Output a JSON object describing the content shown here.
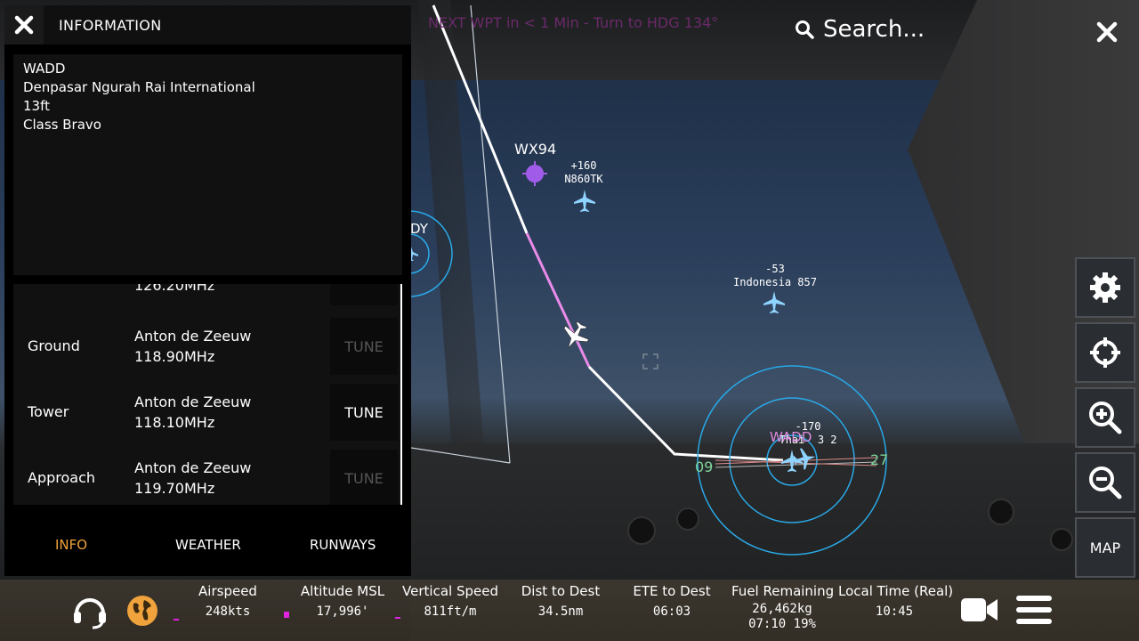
{
  "map": {
    "waypoint_message": "NEXT WPT in < 1 Min - Turn to HDG 134°",
    "weather_station": "WX94",
    "aircraft": [
      {
        "alt": "+160",
        "callsign": "N860TK"
      },
      {
        "alt": "-53",
        "callsign": "Indonesia 857"
      },
      {
        "alt": "-170",
        "callsign": "Thai  3 2"
      }
    ],
    "airport_code": "WADD",
    "runway_west": "09",
    "runway_east": "27",
    "partial_label": "DY"
  },
  "search": {
    "placeholder": "Search..."
  },
  "right_buttons": {
    "map_label": "MAP"
  },
  "panel": {
    "title": "INFORMATION",
    "info_lines": [
      "WADD",
      "Denpasar Ngurah Rai International",
      "13ft",
      "Class Bravo"
    ],
    "frequencies": [
      {
        "name": "",
        "controller": "",
        "freq": "126.20MHz",
        "tune": "",
        "enabled": false
      },
      {
        "name": "Ground",
        "controller": "Anton de Zeeuw",
        "freq": "118.90MHz",
        "tune": "TUNE",
        "enabled": false
      },
      {
        "name": "Tower",
        "controller": "Anton de Zeeuw",
        "freq": "118.10MHz",
        "tune": "TUNE",
        "enabled": true
      },
      {
        "name": "Approach",
        "controller": "Anton de Zeeuw",
        "freq": "119.70MHz",
        "tune": "TUNE",
        "enabled": false
      }
    ],
    "tabs": [
      "INFO",
      "WEATHER",
      "RUNWAYS"
    ],
    "active_tab": "INFO"
  },
  "status_bar": {
    "airspeed": {
      "label": "Airspeed",
      "value": "248kts"
    },
    "altitude": {
      "label": "Altitude MSL",
      "value": "17,996'"
    },
    "vspeed": {
      "label": "Vertical Speed",
      "value": "811ft/m"
    },
    "dist": {
      "label": "Dist to Dest",
      "value": "34.5nm"
    },
    "ete": {
      "label": "ETE to Dest",
      "value": "06:03"
    },
    "fuel": {
      "label": "Fuel Remaining",
      "value": "26,462kg",
      "value2": "07:10 19%"
    },
    "time": {
      "label": "Local Time (Real)",
      "value": "10:45"
    }
  },
  "colors": {
    "accent": "#f0a23c",
    "route": "#e98be9",
    "range_ring": "#29a9e8",
    "marker": "#e021e0"
  }
}
